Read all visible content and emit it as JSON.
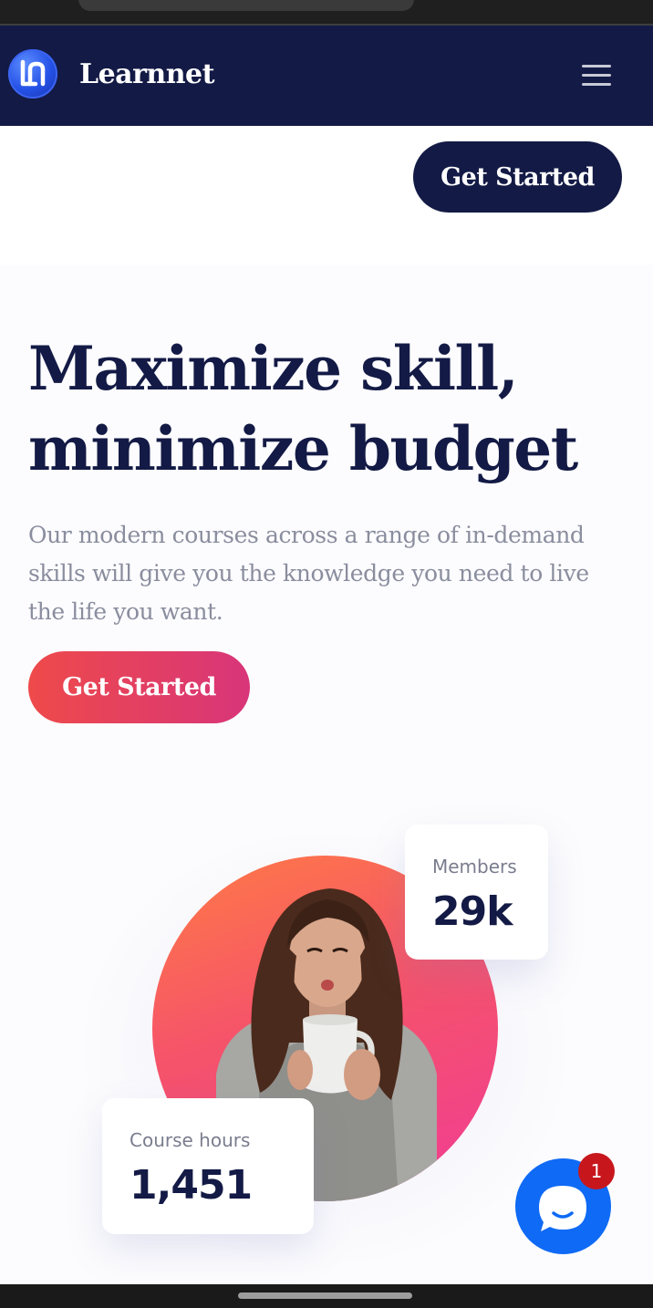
{
  "header": {
    "brand": "Learnnet",
    "logo_icon": "learnnet-logo-icon",
    "menu_icon": "hamburger-menu-icon",
    "top_cta_label": "Get Started"
  },
  "hero": {
    "title_line1": "Maximize skill,",
    "title_line2": "minimize budget",
    "subtitle": "Our modern courses across a range of in-demand skills will give you the knowledge you need to live the life you want.",
    "cta_label": "Get Started"
  },
  "stats": {
    "members_label": "Members",
    "members_value": "29k",
    "hours_label": "Course hours",
    "hours_value": "1,451"
  },
  "chat": {
    "icon": "chat-bubble-icon",
    "badge_count": "1"
  },
  "colors": {
    "navy": "#131a45",
    "gradient_start": "#ee4a4a",
    "gradient_end": "#d8357a",
    "chat_blue": "#0f6af5",
    "badge_red": "#c8161d"
  }
}
